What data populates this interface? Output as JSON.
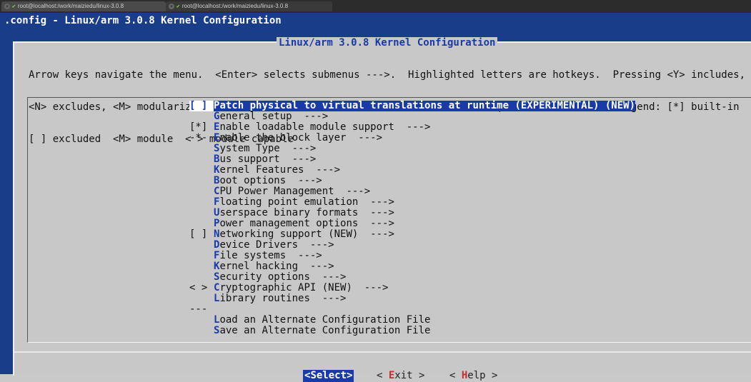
{
  "tabs": [
    {
      "label": "root@localhost:/work/maiziedu/linux-3.0.8"
    },
    {
      "label": "root@localhost:/work/maiziedu/linux-3.0.8"
    }
  ],
  "config_title": ".config - Linux/arm 3.0.8 Kernel Configuration",
  "dialog": {
    "title": "Linux/arm 3.0.8 Kernel Configuration",
    "help": [
      "Arrow keys navigate the menu.  <Enter> selects submenus --->.  Highlighted letters are hotkeys.  Pressing <Y> includes,",
      "<N> excludes, <M> modularizes features.  Press <Esc><Esc> to exit, <?> for Help, </> for Search.  Legend: [*] built-in",
      "[ ] excluded  <M> module  < > module capable"
    ]
  },
  "menu": [
    {
      "prefix": "[ ]",
      "hotkey": "P",
      "text": "atch physical to virtual translations at runtime (EXPERIMENTAL) (NEW)",
      "selected": true
    },
    {
      "prefix": "",
      "hotkey": "G",
      "text": "eneral setup  --->"
    },
    {
      "prefix": "[*]",
      "hotkey": "E",
      "text": "nable loadable module support  --->"
    },
    {
      "prefix": "-*-",
      "hotkey": "E",
      "text": "nable the block layer  --->"
    },
    {
      "prefix": "",
      "hotkey": "S",
      "text": "ystem Type  --->"
    },
    {
      "prefix": "",
      "hotkey": "B",
      "text": "us support  --->"
    },
    {
      "prefix": "",
      "hotkey": "K",
      "text": "ernel Features  --->"
    },
    {
      "prefix": "",
      "hotkey": "B",
      "text": "oot options  --->"
    },
    {
      "prefix": "",
      "hotkey": "C",
      "text": "PU Power Management  --->"
    },
    {
      "prefix": "",
      "hotkey": "F",
      "text": "loating point emulation  --->"
    },
    {
      "prefix": "",
      "hotkey": "U",
      "text": "serspace binary formats  --->"
    },
    {
      "prefix": "",
      "hotkey": "P",
      "text": "ower management options  --->"
    },
    {
      "prefix": "[ ]",
      "hotkey": "N",
      "text": "etworking support (NEW)  --->"
    },
    {
      "prefix": "",
      "hotkey": "D",
      "text": "evice Drivers  --->"
    },
    {
      "prefix": "",
      "hotkey": "F",
      "text": "ile systems  --->"
    },
    {
      "prefix": "",
      "hotkey": "K",
      "text": "ernel hacking  --->"
    },
    {
      "prefix": "",
      "hotkey": "S",
      "text": "ecurity options  --->"
    },
    {
      "prefix": "< >",
      "hotkey": "C",
      "text": "ryptographic API (NEW)  --->"
    },
    {
      "prefix": "",
      "hotkey": "L",
      "text": "ibrary routines  --->"
    },
    {
      "prefix": "---",
      "hotkey": "",
      "text": ""
    },
    {
      "prefix": "",
      "hotkey": "L",
      "text": "oad an Alternate Configuration File"
    },
    {
      "prefix": "",
      "hotkey": "S",
      "text": "ave an Alternate Configuration File"
    }
  ],
  "buttons": {
    "select": {
      "open": "<",
      "hotkey": "S",
      "rest": "elect",
      "close": ">"
    },
    "exit": {
      "open": "< ",
      "hotkey": "E",
      "rest": "xit",
      "close": " >"
    },
    "help": {
      "open": "< ",
      "hotkey": "H",
      "rest": "elp",
      "close": " >"
    }
  },
  "colors": {
    "terminal_bg": "#1a3d8a",
    "dialog_bg": "#c8c8c8",
    "hotkey": "#1a3aa8",
    "button_hotkey": "#c23030",
    "selection_bg": "#1a3aa8"
  }
}
